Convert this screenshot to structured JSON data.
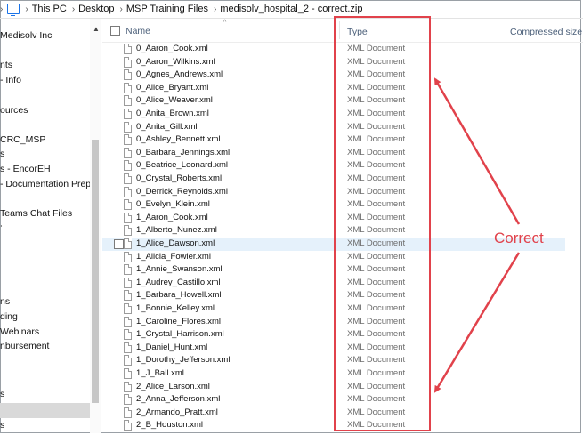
{
  "address_bar": {
    "chevron": "›",
    "crumbs": [
      "This PC",
      "Desktop",
      "MSP Training Files",
      "medisolv_hospital_2 - correct.zip"
    ]
  },
  "nav_pane": {
    "items": [
      "Medisolv Inc",
      "nts",
      "- Info",
      "ources",
      "CRC_MSP",
      "s",
      "s - EncorEH",
      "- Documentation Prep",
      "Teams Chat Files",
      ":",
      "ns",
      "ding",
      "Webinars",
      "nbursement",
      "s",
      "s"
    ]
  },
  "columns": {
    "name": "Name",
    "type": "Type",
    "size": "Compressed size"
  },
  "files": [
    {
      "name": "0_Aaron_Cook.xml",
      "type": "XML Document"
    },
    {
      "name": "0_Aaron_Wilkins.xml",
      "type": "XML Document"
    },
    {
      "name": "0_Agnes_Andrews.xml",
      "type": "XML Document"
    },
    {
      "name": "0_Alice_Bryant.xml",
      "type": "XML Document"
    },
    {
      "name": "0_Alice_Weaver.xml",
      "type": "XML Document"
    },
    {
      "name": "0_Anita_Brown.xml",
      "type": "XML Document"
    },
    {
      "name": "0_Anita_Gill.xml",
      "type": "XML Document"
    },
    {
      "name": "0_Ashley_Bennett.xml",
      "type": "XML Document"
    },
    {
      "name": "0_Barbara_Jennings.xml",
      "type": "XML Document"
    },
    {
      "name": "0_Beatrice_Leonard.xml",
      "type": "XML Document"
    },
    {
      "name": "0_Crystal_Roberts.xml",
      "type": "XML Document"
    },
    {
      "name": "0_Derrick_Reynolds.xml",
      "type": "XML Document"
    },
    {
      "name": "0_Evelyn_Klein.xml",
      "type": "XML Document"
    },
    {
      "name": "1_Aaron_Cook.xml",
      "type": "XML Document"
    },
    {
      "name": "1_Alberto_Nunez.xml",
      "type": "XML Document"
    },
    {
      "name": "1_Alice_Dawson.xml",
      "type": "XML Document",
      "hover": true
    },
    {
      "name": "1_Alicia_Fowler.xml",
      "type": "XML Document"
    },
    {
      "name": "1_Annie_Swanson.xml",
      "type": "XML Document"
    },
    {
      "name": "1_Audrey_Castillo.xml",
      "type": "XML Document"
    },
    {
      "name": "1_Barbara_Howell.xml",
      "type": "XML Document"
    },
    {
      "name": "1_Bonnie_Kelley.xml",
      "type": "XML Document"
    },
    {
      "name": "1_Caroline_Flores.xml",
      "type": "XML Document"
    },
    {
      "name": "1_Crystal_Harrison.xml",
      "type": "XML Document"
    },
    {
      "name": "1_Daniel_Hunt.xml",
      "type": "XML Document"
    },
    {
      "name": "1_Dorothy_Jefferson.xml",
      "type": "XML Document"
    },
    {
      "name": "1_J_Ball.xml",
      "type": "XML Document"
    },
    {
      "name": "2_Alice_Larson.xml",
      "type": "XML Document"
    },
    {
      "name": "2_Anna_Jefferson.xml",
      "type": "XML Document"
    },
    {
      "name": "2_Armando_Pratt.xml",
      "type": "XML Document"
    },
    {
      "name": "2_B_Houston.xml",
      "type": "XML Document"
    }
  ],
  "annotation": {
    "label": "Correct",
    "color": "#e1424b"
  }
}
